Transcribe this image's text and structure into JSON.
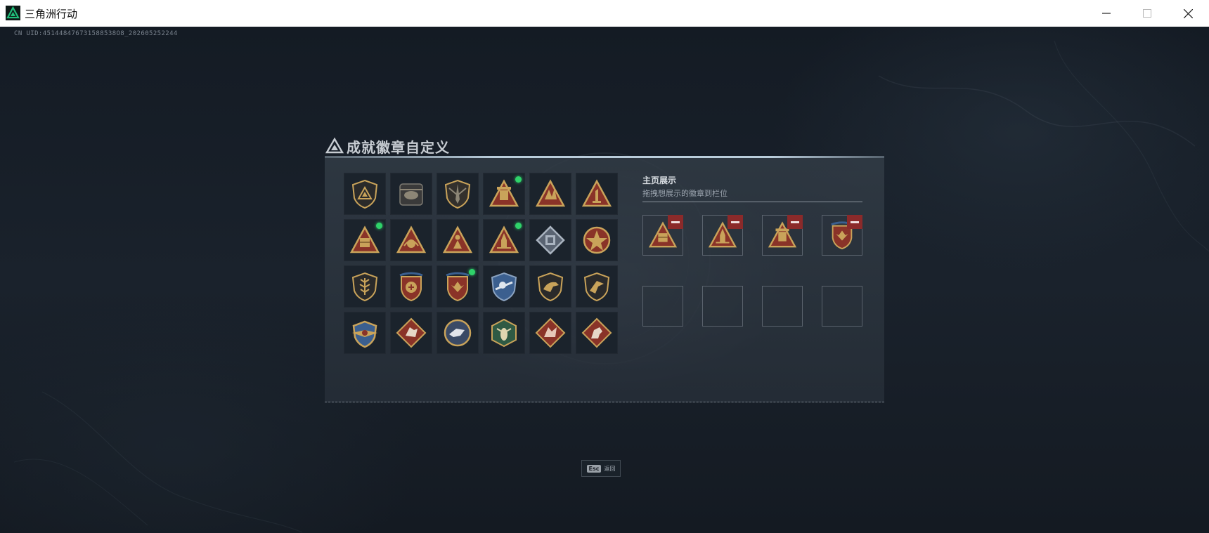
{
  "window": {
    "title": "三角洲行动",
    "controls": [
      "minimize",
      "maximize",
      "close"
    ]
  },
  "uid_text": "CN UID:451448476731588538O8_202605252244",
  "panel": {
    "title": "成就徽章自定义",
    "badges": [
      {
        "icon": "delta-shield-badge-icon",
        "new": false
      },
      {
        "icon": "helicopter-badge-icon",
        "new": false
      },
      {
        "icon": "blade-shield-badge-icon",
        "new": false
      },
      {
        "icon": "tower-triangle-badge-icon",
        "new": true
      },
      {
        "icon": "claw-triangle-badge-icon",
        "new": false
      },
      {
        "icon": "number-one-triangle-badge-icon",
        "new": false
      },
      {
        "icon": "crate-triangle-badge-icon",
        "new": true
      },
      {
        "icon": "emblem-triangle-badge-icon",
        "new": false
      },
      {
        "icon": "figure-triangle-badge-icon",
        "new": false
      },
      {
        "icon": "rocket-triangle-badge-icon",
        "new": true
      },
      {
        "icon": "silver-diamond-badge-icon",
        "new": false
      },
      {
        "icon": "star-medal-badge-icon",
        "new": false
      },
      {
        "icon": "wheat-shield-badge-icon",
        "new": false
      },
      {
        "icon": "red-crest-badge-icon",
        "new": false
      },
      {
        "icon": "red-eagle-crest-badge-icon",
        "new": true
      },
      {
        "icon": "blue-eagle-shield-badge-icon",
        "new": false
      },
      {
        "icon": "dino-shield-badge-icon",
        "new": false
      },
      {
        "icon": "raptor-shield-badge-icon",
        "new": false
      },
      {
        "icon": "golden-wings-badge-icon",
        "new": false
      },
      {
        "icon": "beast-diamond-badge-icon",
        "new": false
      },
      {
        "icon": "wolf-circle-badge-icon",
        "new": false
      },
      {
        "icon": "wasp-hexagon-badge-icon",
        "new": false
      },
      {
        "icon": "dragon-diamond-badge-icon",
        "new": false
      },
      {
        "icon": "horse-diamond-badge-icon",
        "new": false
      }
    ],
    "showcase": {
      "title": "主页展示",
      "subtitle": "拖拽想展示的徽章到栏位",
      "slots": [
        {
          "icon": "crate-triangle-badge-icon",
          "filled": true
        },
        {
          "icon": "rocket-triangle-badge-icon",
          "filled": true
        },
        {
          "icon": "tower-triangle-badge-icon",
          "filled": true
        },
        {
          "icon": "red-eagle-crest-badge-icon",
          "filled": true
        },
        {
          "icon": "",
          "filled": false
        },
        {
          "icon": "",
          "filled": false
        },
        {
          "icon": "",
          "filled": false
        },
        {
          "icon": "",
          "filled": false
        }
      ]
    }
  },
  "footer": {
    "esc_key": "Esc",
    "esc_label": "返回"
  },
  "colors": {
    "new_indicator": "#2fd36a",
    "remove_button": "#8b2a2a",
    "gold": "#c9a35a",
    "accent_logo": "#1fbf7a"
  }
}
